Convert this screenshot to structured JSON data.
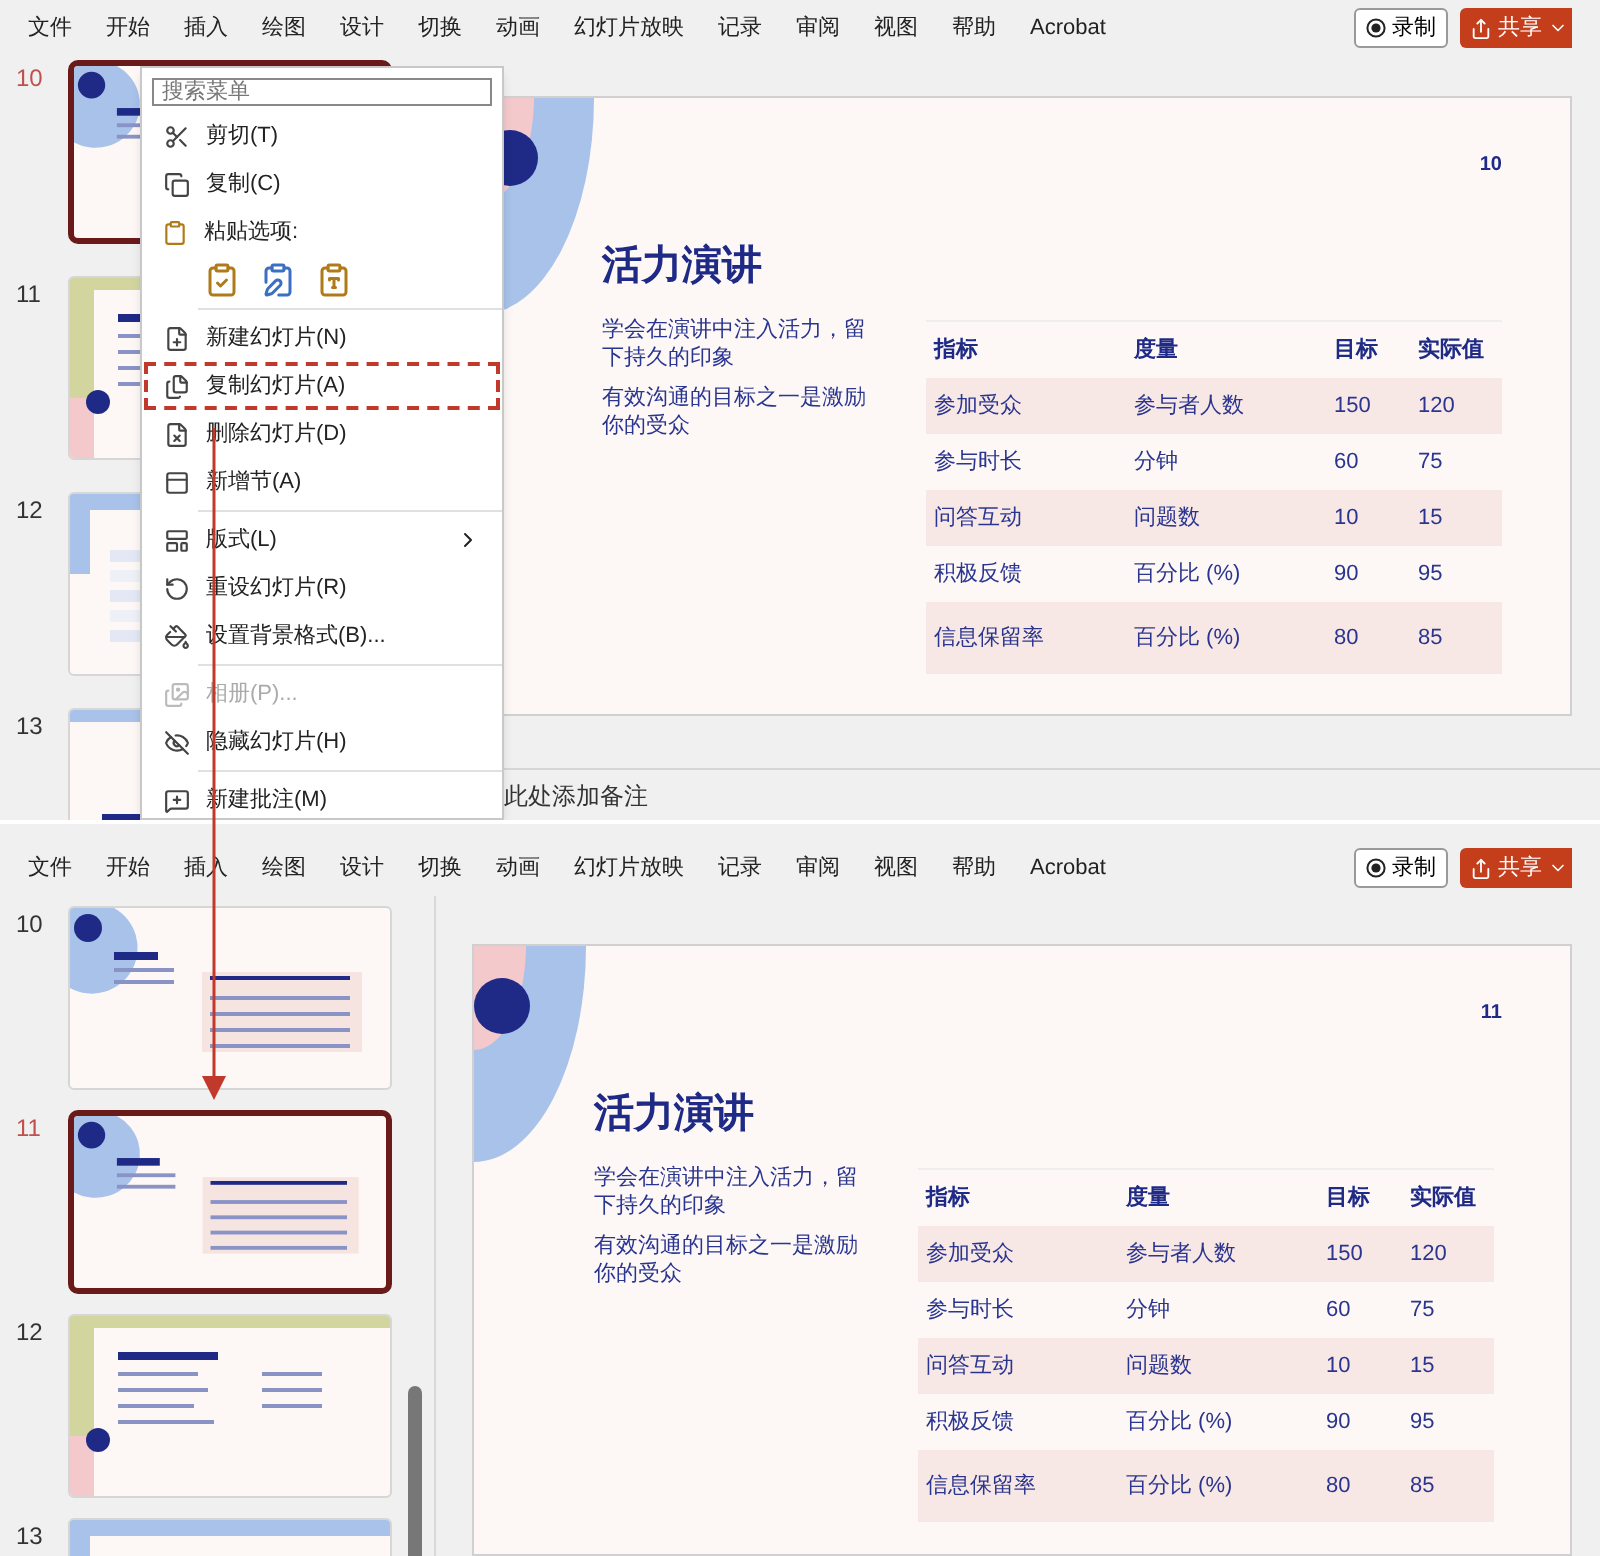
{
  "panels": [
    {
      "menu": [
        "文件",
        "开始",
        "插入",
        "绘图",
        "设计",
        "切换",
        "动画",
        "幻灯片放映",
        "记录",
        "审阅",
        "视图",
        "帮助",
        "Acrobat"
      ],
      "record_button": "录制",
      "share_button": "共享",
      "thumbnails": [
        {
          "number": "10",
          "selected": true,
          "kind": "table"
        },
        {
          "number": "11",
          "selected": false,
          "kind": "tips"
        },
        {
          "number": "12",
          "selected": false,
          "kind": "list"
        },
        {
          "number": "13",
          "selected": false,
          "kind": "thanks"
        }
      ],
      "slide": {
        "number": "10",
        "title": "活力演讲",
        "paragraphs": [
          "学会在演讲中注入活力，留下持久的印象",
          "有效沟通的目标之一是激励你的受众"
        ],
        "columns": [
          "指标",
          "度量",
          "目标",
          "实际值"
        ],
        "rows": [
          [
            "参加受众",
            "参与者人数",
            "150",
            "120"
          ],
          [
            "参与时长",
            "分钟",
            "60",
            "75"
          ],
          [
            "问答互动",
            "问题数",
            "10",
            "15"
          ],
          [
            "积极反馈",
            "百分比 (%)",
            "90",
            "95"
          ],
          [
            "信息保留率",
            "百分比 (%)",
            "80",
            "85"
          ]
        ]
      },
      "notes_placeholder": "此处添加备注",
      "context_menu": {
        "placeholder": "搜索菜单",
        "items": [
          {
            "kind": "item",
            "label": "剪切(T)",
            "selected": false,
            "disabled": false
          },
          {
            "kind": "item",
            "label": "复制(C)",
            "selected": false,
            "disabled": false
          },
          {
            "kind": "paste",
            "label": "粘贴选项:"
          },
          {
            "kind": "separator"
          },
          {
            "kind": "item",
            "label": "新建幻灯片(N)",
            "selected": false,
            "disabled": false
          },
          {
            "kind": "item",
            "label": "复制幻灯片(A)",
            "selected": true,
            "disabled": false
          },
          {
            "kind": "item",
            "label": "删除幻灯片(D)",
            "selected": false,
            "disabled": false
          },
          {
            "kind": "item",
            "label": "新增节(A)",
            "selected": false,
            "disabled": false
          },
          {
            "kind": "separator"
          },
          {
            "kind": "submenu",
            "label": "版式(L)",
            "selected": false,
            "disabled": false
          },
          {
            "kind": "item",
            "label": "重设幻灯片(R)",
            "selected": false,
            "disabled": false
          },
          {
            "kind": "item",
            "label": "设置背景格式(B)...",
            "selected": false,
            "disabled": false
          },
          {
            "kind": "separator"
          },
          {
            "kind": "item",
            "label": "相册(P)...",
            "selected": false,
            "disabled": true
          },
          {
            "kind": "item",
            "label": "隐藏幻灯片(H)",
            "selected": false,
            "disabled": false
          },
          {
            "kind": "separator"
          },
          {
            "kind": "item",
            "label": "新建批注(M)",
            "selected": false,
            "disabled": false
          }
        ]
      }
    },
    {
      "menu": [
        "文件",
        "开始",
        "插入",
        "绘图",
        "设计",
        "切换",
        "动画",
        "幻灯片放映",
        "记录",
        "审阅",
        "视图",
        "帮助",
        "Acrobat"
      ],
      "record_button": "录制",
      "share_button": "共享",
      "thumbnails": [
        {
          "number": "10",
          "selected": false,
          "kind": "table"
        },
        {
          "number": "11",
          "selected": true,
          "kind": "table"
        },
        {
          "number": "12",
          "selected": false,
          "kind": "tips"
        },
        {
          "number": "13",
          "selected": false,
          "kind": "list"
        }
      ],
      "slide": {
        "number": "11",
        "title": "活力演讲",
        "paragraphs": [
          "学会在演讲中注入活力，留下持久的印象",
          "有效沟通的目标之一是激励你的受众"
        ],
        "columns": [
          "指标",
          "度量",
          "目标",
          "实际值"
        ],
        "rows": [
          [
            "参加受众",
            "参与者人数",
            "150",
            "120"
          ],
          [
            "参与时长",
            "分钟",
            "60",
            "75"
          ],
          [
            "问答互动",
            "问题数",
            "10",
            "15"
          ],
          [
            "积极反馈",
            "百分比 (%)",
            "90",
            "95"
          ],
          [
            "信息保留率",
            "百分比 (%)",
            "80",
            "85"
          ]
        ]
      }
    }
  ]
}
